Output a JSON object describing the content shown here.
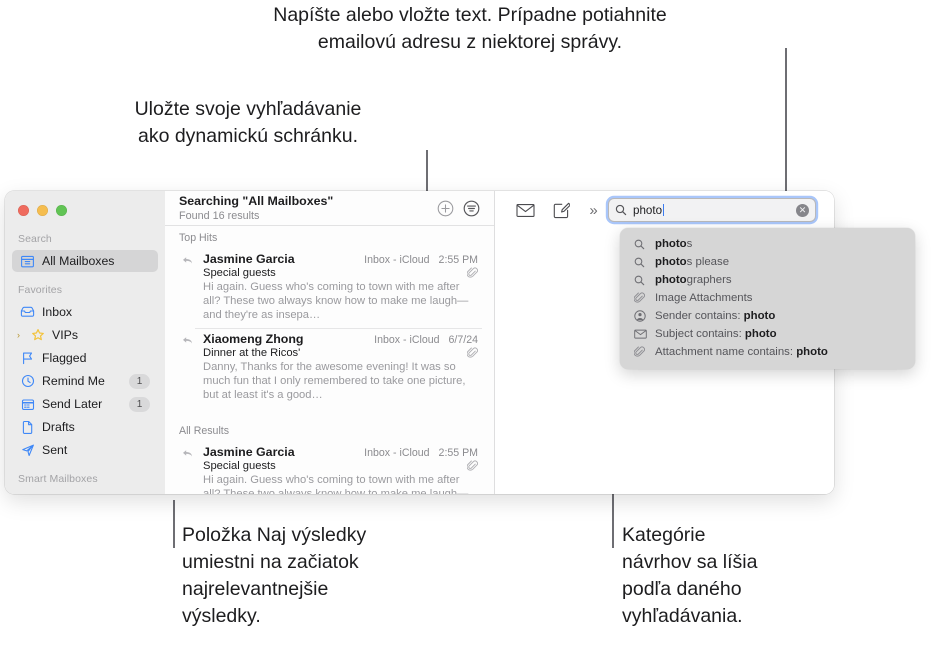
{
  "callouts": {
    "top": "Napíšte alebo vložte text. Prípadne potiahnite\nemailovú adresu z niektorej správy.",
    "left": "Uložte svoje vyhľadávanie\nako dynamickú schránku.",
    "bottom_left": "Položka Naj výsledky\numiestni na začiatok\nnajrelevantnejšie\nvýsledky.",
    "bottom_right": "Kategórie\nnávrhov sa líšia\npodľa daného\nvyhľadávania."
  },
  "window": {
    "traffic_lights": {
      "close": "close-button",
      "minimize": "minimize-button",
      "zoom": "zoom-button"
    }
  },
  "sidebar": {
    "sections": [
      {
        "header": "Search",
        "items": [
          {
            "label": "All Mailboxes",
            "icon": "all-mailboxes-icon",
            "selected": true,
            "badge": "",
            "disclosure": false
          }
        ]
      },
      {
        "header": "Favorites",
        "items": [
          {
            "label": "Inbox",
            "icon": "inbox-icon",
            "selected": false,
            "badge": "",
            "disclosure": false
          },
          {
            "label": "VIPs",
            "icon": "star-icon",
            "selected": false,
            "badge": "",
            "disclosure": true
          },
          {
            "label": "Flagged",
            "icon": "flag-icon",
            "selected": false,
            "badge": "",
            "disclosure": false
          },
          {
            "label": "Remind Me",
            "icon": "clock-icon",
            "selected": false,
            "badge": "1",
            "disclosure": false
          },
          {
            "label": "Send Later",
            "icon": "calendar-icon",
            "selected": false,
            "badge": "1",
            "disclosure": false
          },
          {
            "label": "Drafts",
            "icon": "document-icon",
            "selected": false,
            "badge": "",
            "disclosure": false
          },
          {
            "label": "Sent",
            "icon": "paper-plane-icon",
            "selected": false,
            "badge": "",
            "disclosure": false
          }
        ]
      },
      {
        "header": "Smart Mailboxes",
        "items": []
      }
    ]
  },
  "list_header": {
    "title": "Searching \"All Mailboxes\"",
    "subtitle": "Found 16 results",
    "save_search_button": "add-smart-mailbox-button",
    "filter_button": "filter-button"
  },
  "message_list": {
    "groups": [
      {
        "label": "Top Hits",
        "messages": [
          {
            "sender": "Jasmine Garcia",
            "mailbox": "Inbox - iCloud",
            "date": "2:55 PM",
            "subject": "Special guests",
            "preview": "Hi again. Guess who's coming to town with me after all? These two always know how to make me laugh—and they're as insepa…",
            "attachment": true
          },
          {
            "sender": "Xiaomeng Zhong",
            "mailbox": "Inbox - iCloud",
            "date": "6/7/24",
            "subject": "Dinner at the Ricos'",
            "preview": "Danny, Thanks for the awesome evening! It was so much fun that I only remembered to take one picture, but at least it's a good…",
            "attachment": true
          }
        ]
      },
      {
        "label": "All Results",
        "messages": [
          {
            "sender": "Jasmine Garcia",
            "mailbox": "Inbox - iCloud",
            "date": "2:55 PM",
            "subject": "Special guests",
            "preview": "Hi again. Guess who's coming to town with me after all? These two always know how to make me laugh—and they're as insepa…",
            "attachment": true
          }
        ]
      }
    ]
  },
  "toolbar": {
    "get_mail_button": "get-mail-icon",
    "compose_button": "compose-icon",
    "overflow": "»"
  },
  "search": {
    "value": "photo",
    "placeholder": "Search",
    "search_icon": "search-icon",
    "clear_icon": "clear-icon"
  },
  "suggestions": [
    {
      "icon": "search-icon",
      "match": "photo",
      "rest": "s",
      "prefix": ""
    },
    {
      "icon": "search-icon",
      "match": "photo",
      "rest": "s please",
      "prefix": ""
    },
    {
      "icon": "search-icon",
      "match": "photo",
      "rest": "graphers",
      "prefix": ""
    },
    {
      "icon": "paperclip-icon",
      "match": "",
      "rest": "Image Attachments",
      "prefix": ""
    },
    {
      "icon": "person-icon",
      "match": "photo",
      "rest": "",
      "prefix": "Sender contains: "
    },
    {
      "icon": "envelope-icon",
      "match": "photo",
      "rest": "",
      "prefix": "Subject contains: "
    },
    {
      "icon": "paperclip-icon",
      "match": "photo",
      "rest": "",
      "prefix": "Attachment name contains: "
    }
  ],
  "colors": {
    "accent_blue": "#3b7cf0",
    "sidebar_bg": "#ececec",
    "dropdown_bg": "#d6d6d6",
    "icon_blue": "#3f88f7",
    "star_yellow": "#f3c33c"
  }
}
